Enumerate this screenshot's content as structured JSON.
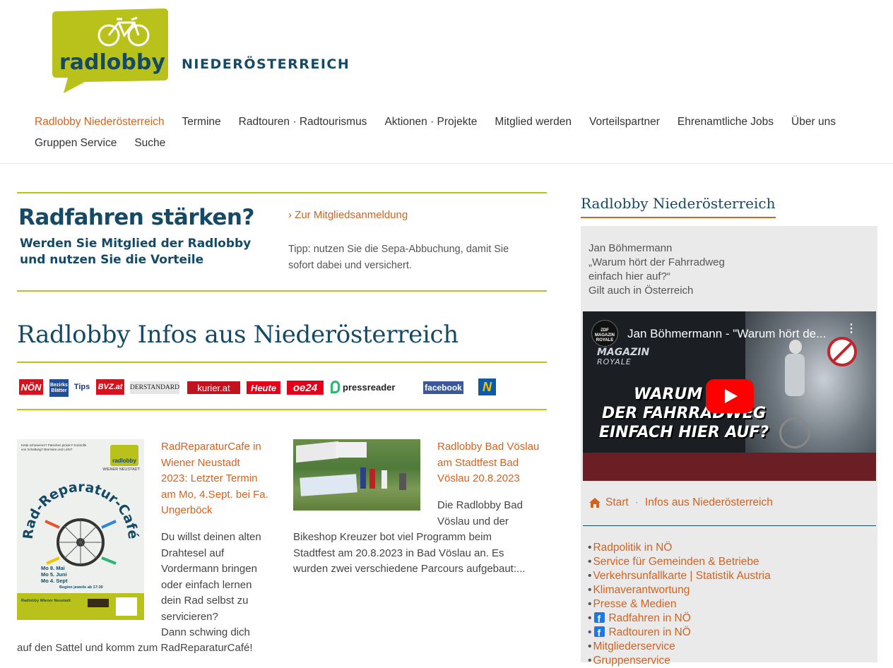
{
  "logo": {
    "text": "radlobby",
    "region": "NIEDERÖSTERREICH"
  },
  "nav": {
    "row1": [
      "Radlobby Niederösterreich",
      "Termine",
      "Radtouren · Radtourismus",
      "Aktionen · Projekte",
      "Mitglied werden",
      "Vorteilspartner",
      "Ehrenamtliche Jobs",
      "Über uns"
    ],
    "row2": [
      "Gruppen Service",
      "Suche"
    ]
  },
  "cta": {
    "headline": "Radfahren stärken?",
    "sub1": "Werden Sie Mitglied der Radlobby",
    "sub2": "und nutzen Sie die Vorteile",
    "link": "› Zur Mitgliedsanmeldung",
    "tip1": "Tipp: nutzen Sie die Sepa-Abbuchung, damit Sie",
    "tip2": "sofort dabei und versichert."
  },
  "infos_title": "Radlobby Infos aus Niederösterreich",
  "media_logos": [
    "NÖN",
    "Bezirks Blätter",
    "Tips",
    "BVZ.at",
    "DERSTANDARD",
    "kurier.at",
    "Heute",
    "oe24",
    "pressreader",
    "facebook",
    "N"
  ],
  "articles": [
    {
      "title_lines": [
        "RadReparaturCafe in",
        "Wiener Neustadt",
        "2023: Letzter Termin",
        "am Mo, 4.Sept. bei Fa.",
        "Ungerböck"
      ],
      "body_lines": [
        "Du willst deinen alten",
        "Drahtesel auf",
        "Vordermann bringen",
        "oder einfach lernen",
        "dein Rad selbst zu",
        "servicieren?",
        "Dann schwing dich"
      ],
      "body_last": "auf den Sattel und komm zum RadReparaturCafé!",
      "poster": {
        "brand": "radlobby",
        "city": "WIENER NEUSTADT",
        "title": "Rad-Reparatur-Café",
        "dates": [
          "Mo 8. Mai",
          "Mo 5. Juni",
          "Mo 4. Sept"
        ],
        "time": "Beginn jeweils ab 17:30",
        "footer": "Radlobby Wiener Neustadt"
      }
    },
    {
      "title_lines": [
        "Radlobby Bad Vöslau",
        "am Stadtfest Bad",
        "Vöslau 20.8.2023"
      ],
      "body_lines": [
        "Die Radlobby Bad",
        "Vöslau und der"
      ],
      "body_wide": [
        "Bikeshop Kreuzer bot viel Programm beim",
        "Stadtfest am 20.8.2023 in Bad Vöslau an. Es",
        "wurden zwei verschiedene Parcours aufgebaut:..."
      ]
    }
  ],
  "sidebar": {
    "title": "Radlobby Niederösterreich",
    "quote": [
      "Jan Böhmermann",
      "„Warum hört der Fahrradweg",
      "einfach hier auf?“",
      "Gilt auch in Österreich"
    ],
    "video": {
      "title": "Jan Böhmermann - \"Warum hört de...",
      "channel": "ZDF MAGAZIN ROYALE",
      "show1": "MAGAZIN",
      "show2": "ROYALE",
      "thumb_lines": [
        "WARUM HÖ",
        "DER FAHRRADWEG",
        "EINFACH HIER AUF?"
      ]
    },
    "breadcrumb": {
      "home": "Start",
      "current": "Infos aus Niederösterreich"
    },
    "links": [
      {
        "label": "Radpolitik in NÖ",
        "fb": false
      },
      {
        "label": "Service für Gemeinden & Betriebe",
        "fb": false
      },
      {
        "label": "Verkehrsunfallkarte | Statistik Austria",
        "fb": false
      },
      {
        "label": "Klimaverantwortung",
        "fb": false
      },
      {
        "label": "Presse & Medien",
        "fb": false
      },
      {
        "label": "Radfahren in NÖ",
        "fb": true
      },
      {
        "label": "Radtouren in NÖ",
        "fb": true
      },
      {
        "label": "Mitgliederservice",
        "fb": false
      },
      {
        "label": "Gruppenservice",
        "fb": false
      }
    ]
  },
  "colors": {
    "lime": "#b9c21a",
    "navy": "#154a66",
    "orange": "#d4621f"
  }
}
